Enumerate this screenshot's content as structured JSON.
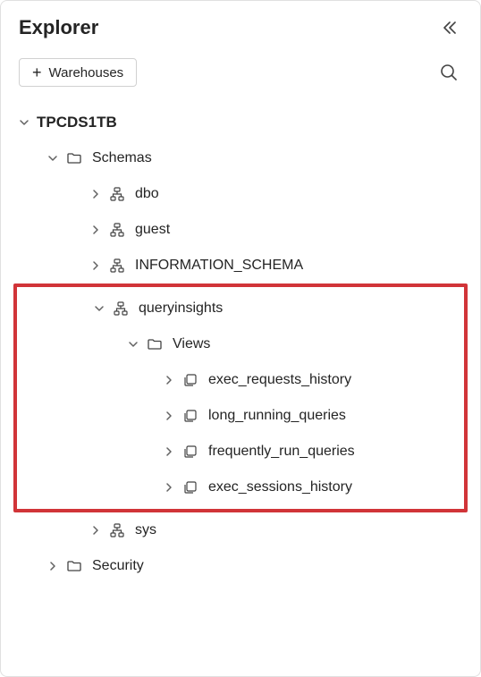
{
  "header": {
    "title": "Explorer"
  },
  "toolbar": {
    "warehouses_label": "Warehouses"
  },
  "tree": {
    "database": {
      "name": "TPCDS1TB",
      "schemas_folder_label": "Schemas",
      "schemas": [
        {
          "name": "dbo"
        },
        {
          "name": "guest"
        },
        {
          "name": "INFORMATION_SCHEMA"
        }
      ],
      "queryinsights": {
        "name": "queryinsights",
        "views_folder_label": "Views",
        "views": [
          {
            "name": "exec_requests_history"
          },
          {
            "name": "long_running_queries"
          },
          {
            "name": "frequently_run_queries"
          },
          {
            "name": "exec_sessions_history"
          }
        ]
      },
      "sys_schema": {
        "name": "sys"
      },
      "security_folder_label": "Security"
    }
  }
}
